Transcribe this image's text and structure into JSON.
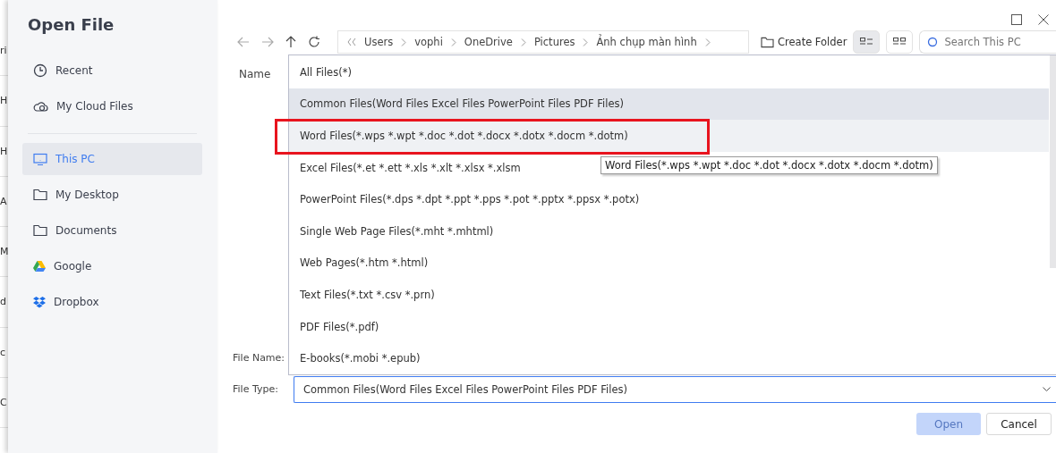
{
  "background_window": {
    "fragments": [
      "ri",
      "H",
      "H",
      "A",
      "M",
      "d",
      "c",
      "C"
    ]
  },
  "window": {
    "title": "Open File"
  },
  "sidebar": {
    "items": [
      {
        "label": "Recent",
        "selected": false
      },
      {
        "label": "My Cloud Files",
        "selected": false
      },
      {
        "label": "This PC",
        "selected": true
      },
      {
        "label": "My Desktop",
        "selected": false
      },
      {
        "label": "Documents",
        "selected": false
      },
      {
        "label": "Google",
        "selected": false
      },
      {
        "label": "Dropbox",
        "selected": false
      }
    ]
  },
  "toolbar": {
    "breadcrumb": [
      "Users",
      "vophi",
      "OneDrive",
      "Pictures",
      "Ảnh chụp màn hình"
    ],
    "create_folder": "Create Folder",
    "views": [
      {
        "kind": "list",
        "selected": true
      },
      {
        "kind": "grid",
        "selected": false
      }
    ],
    "search": {
      "placeholder": "Search This PC"
    }
  },
  "file_list": {
    "columns": [
      "Name"
    ]
  },
  "file_type_dropdown": {
    "options": [
      {
        "label": "All Files(*)",
        "selected": false,
        "hovered": false
      },
      {
        "label": "Common Files(Word Files Excel Files PowerPoint Files PDF Files)",
        "selected": true,
        "hovered": false
      },
      {
        "label": "Word Files(*.wps *.wpt *.doc *.dot *.docx *.dotx *.docm *.dotm)",
        "selected": false,
        "hovered": true,
        "annotated": true
      },
      {
        "label": "Excel Files(*.et *.ett *.xls *.xlt *.xlsx *.xlsm",
        "selected": false,
        "hovered": false
      },
      {
        "label": "PowerPoint Files(*.dps *.dpt *.ppt *.pps *.pot *.pptx *.ppsx *.potx)",
        "selected": false,
        "hovered": false
      },
      {
        "label": "Single Web Page Files(*.mht *.mhtml)",
        "selected": false,
        "hovered": false
      },
      {
        "label": "Web Pages(*.htm *.html)",
        "selected": false,
        "hovered": false
      },
      {
        "label": "Text Files(*.txt *.csv *.prn)",
        "selected": false,
        "hovered": false
      },
      {
        "label": "PDF Files(*.pdf)",
        "selected": false,
        "hovered": false
      },
      {
        "label": "E-books(*.mobi *.epub)",
        "selected": false,
        "hovered": false
      }
    ],
    "tooltip": "Word Files(*.wps *.wpt *.doc *.dot *.docx *.dotx *.docm *.dotm)"
  },
  "form": {
    "file_name_label": "File Name:",
    "file_type_label": "File Type:",
    "file_type_value": "Common Files(Word Files Excel Files PowerPoint Files PDF Files)"
  },
  "buttons": [
    {
      "label": "Open",
      "disabled": true,
      "kind": "primary"
    },
    {
      "label": "Cancel",
      "disabled": false,
      "kind": "secondary"
    }
  ]
}
